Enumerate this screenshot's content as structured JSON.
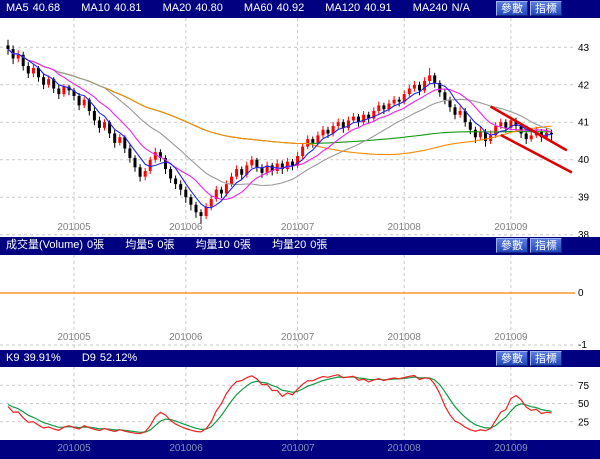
{
  "colors": {
    "header_bg": "#000080",
    "button_bg": "#2347b8",
    "button_text": "#ffffff",
    "chart_bg": "#ffffff",
    "grid": "#c9c9c9",
    "axis_text": "#000000",
    "date_text": "#808080",
    "bottom_date_text": "#8890b8",
    "up": "#ff0000",
    "down": "#000000",
    "trendline": "#dd0000",
    "ma5": "#2222ee",
    "ma10": "#ee22ee",
    "ma20": "#999999",
    "ma60": "#ff8800",
    "ma120": "#119911",
    "k_line": "#ee2222",
    "d_line": "#119944",
    "zero_line": "#ff8800"
  },
  "buttons": {
    "params": "參數",
    "indicator": "指標"
  },
  "panels": {
    "main": {
      "header": [
        {
          "label": "MA5",
          "value": "40.68"
        },
        {
          "label": "MA10",
          "value": "40.81"
        },
        {
          "label": "MA20",
          "value": "40.80"
        },
        {
          "label": "MA60",
          "value": "40.92"
        },
        {
          "label": "MA120",
          "value": "40.91"
        },
        {
          "label": "MA240",
          "value": "N/A"
        }
      ]
    },
    "volume": {
      "header": [
        {
          "label": "成交量(Volume)",
          "value": "0張"
        },
        {
          "label": "均量5",
          "value": "0張"
        },
        {
          "label": "均量10",
          "value": "0張"
        },
        {
          "label": "均量20",
          "value": "0張"
        }
      ]
    },
    "kd": {
      "header": [
        {
          "label": "K9",
          "value": "39.91%"
        },
        {
          "label": "D9",
          "value": "52.12%"
        }
      ]
    }
  },
  "chart_data": [
    {
      "type": "candlestick",
      "title": "daily candlestick with moving averages",
      "y_ticks": [
        43,
        42,
        41,
        40,
        39,
        38
      ],
      "ylim": [
        37.94,
        43.78
      ],
      "x_tick_labels": [
        "201005",
        "201006",
        "201007",
        "201008",
        "201009"
      ],
      "x_tick_indices": [
        13,
        35,
        57,
        78,
        99
      ],
      "ma_periods": [
        5,
        10,
        20,
        60,
        120
      ],
      "candles": [
        [
          43.05,
          43.2,
          42.8,
          42.95
        ],
        [
          42.95,
          43.05,
          42.55,
          42.7
        ],
        [
          42.7,
          42.92,
          42.6,
          42.8
        ],
        [
          42.8,
          42.88,
          42.38,
          42.5
        ],
        [
          42.5,
          42.6,
          42.18,
          42.3
        ],
        [
          42.3,
          42.55,
          42.2,
          42.45
        ],
        [
          42.45,
          42.5,
          42.08,
          42.2
        ],
        [
          42.2,
          42.3,
          41.88,
          42.0
        ],
        [
          42.0,
          42.25,
          41.92,
          42.15
        ],
        [
          42.15,
          42.2,
          41.78,
          41.9
        ],
        [
          41.9,
          42.0,
          41.62,
          41.75
        ],
        [
          41.75,
          42.02,
          41.68,
          41.95
        ],
        [
          41.95,
          42.0,
          41.72,
          41.85
        ],
        [
          41.85,
          41.92,
          41.58,
          41.7
        ],
        [
          41.7,
          41.78,
          41.32,
          41.45
        ],
        [
          41.45,
          41.68,
          41.38,
          41.6
        ],
        [
          41.6,
          41.65,
          41.18,
          41.3
        ],
        [
          41.3,
          41.4,
          40.92,
          41.05
        ],
        [
          41.05,
          41.15,
          40.72,
          40.85
        ],
        [
          40.85,
          41.08,
          40.78,
          41.0
        ],
        [
          41.0,
          41.05,
          40.58,
          40.7
        ],
        [
          40.7,
          40.8,
          40.32,
          40.45
        ],
        [
          40.45,
          40.68,
          40.38,
          40.6
        ],
        [
          40.6,
          40.65,
          40.18,
          40.3
        ],
        [
          40.3,
          40.4,
          39.92,
          40.05
        ],
        [
          40.05,
          40.12,
          39.68,
          39.8
        ],
        [
          39.8,
          39.88,
          39.42,
          39.55
        ],
        [
          39.55,
          39.78,
          39.45,
          39.7
        ],
        [
          39.7,
          40.08,
          39.62,
          40.0
        ],
        [
          40.0,
          40.32,
          39.92,
          40.2
        ],
        [
          40.2,
          40.28,
          39.95,
          40.05
        ],
        [
          40.05,
          40.12,
          39.62,
          39.75
        ],
        [
          39.75,
          39.82,
          39.38,
          39.5
        ],
        [
          39.5,
          39.58,
          39.22,
          39.35
        ],
        [
          39.35,
          39.45,
          39.05,
          39.2
        ],
        [
          39.2,
          39.28,
          38.85,
          39.0
        ],
        [
          39.0,
          39.08,
          38.65,
          38.8
        ],
        [
          38.8,
          38.88,
          38.45,
          38.6
        ],
        [
          38.6,
          38.68,
          38.3,
          38.5
        ],
        [
          38.5,
          38.85,
          38.42,
          38.75
        ],
        [
          38.75,
          39.05,
          38.65,
          38.95
        ],
        [
          38.95,
          39.3,
          38.88,
          39.2
        ],
        [
          39.2,
          39.28,
          38.98,
          39.1
        ],
        [
          39.1,
          39.45,
          39.02,
          39.35
        ],
        [
          39.35,
          39.65,
          39.28,
          39.55
        ],
        [
          39.55,
          39.85,
          39.48,
          39.75
        ],
        [
          39.75,
          39.82,
          39.48,
          39.6
        ],
        [
          39.6,
          39.95,
          39.52,
          39.85
        ],
        [
          39.85,
          40.1,
          39.78,
          40.0
        ],
        [
          40.0,
          40.05,
          39.68,
          39.8
        ],
        [
          39.8,
          39.88,
          39.52,
          39.65
        ],
        [
          39.65,
          39.95,
          39.58,
          39.85
        ],
        [
          39.85,
          39.92,
          39.58,
          39.7
        ],
        [
          39.7,
          40.0,
          39.62,
          39.9
        ],
        [
          39.9,
          39.98,
          39.62,
          39.75
        ],
        [
          39.75,
          40.05,
          39.68,
          39.95
        ],
        [
          39.95,
          40.02,
          39.72,
          39.85
        ],
        [
          39.85,
          40.2,
          39.78,
          40.1
        ],
        [
          40.1,
          40.45,
          40.02,
          40.35
        ],
        [
          40.35,
          40.65,
          40.28,
          40.55
        ],
        [
          40.55,
          40.62,
          40.32,
          40.45
        ],
        [
          40.45,
          40.75,
          40.38,
          40.65
        ],
        [
          40.65,
          40.9,
          40.58,
          40.8
        ],
        [
          40.8,
          40.88,
          40.58,
          40.7
        ],
        [
          40.7,
          41.0,
          40.62,
          40.9
        ],
        [
          40.9,
          41.1,
          40.82,
          41.0
        ],
        [
          41.0,
          41.08,
          40.72,
          40.85
        ],
        [
          40.85,
          41.15,
          40.78,
          41.05
        ],
        [
          41.05,
          41.25,
          40.98,
          41.15
        ],
        [
          41.15,
          41.22,
          40.88,
          41.0
        ],
        [
          41.0,
          41.3,
          40.92,
          41.2
        ],
        [
          41.2,
          41.28,
          40.98,
          41.1
        ],
        [
          41.1,
          41.4,
          41.02,
          41.3
        ],
        [
          41.3,
          41.55,
          41.22,
          41.45
        ],
        [
          41.45,
          41.52,
          41.22,
          41.35
        ],
        [
          41.35,
          41.6,
          41.28,
          41.5
        ],
        [
          41.5,
          41.7,
          41.42,
          41.6
        ],
        [
          41.6,
          41.68,
          41.42,
          41.55
        ],
        [
          41.55,
          41.85,
          41.48,
          41.75
        ],
        [
          41.75,
          42.0,
          41.68,
          41.9
        ],
        [
          41.9,
          42.1,
          41.82,
          42.0
        ],
        [
          42.0,
          42.08,
          41.72,
          41.85
        ],
        [
          41.85,
          42.2,
          41.78,
          42.1
        ],
        [
          42.1,
          42.45,
          42.02,
          42.25
        ],
        [
          42.25,
          42.32,
          41.92,
          42.05
        ],
        [
          42.05,
          42.12,
          41.68,
          41.8
        ],
        [
          41.8,
          41.88,
          41.48,
          41.6
        ],
        [
          41.6,
          41.68,
          41.28,
          41.4
        ],
        [
          41.4,
          41.48,
          41.08,
          41.2
        ],
        [
          41.2,
          41.42,
          41.12,
          41.3
        ],
        [
          41.3,
          41.38,
          40.88,
          41.0
        ],
        [
          41.0,
          41.08,
          40.68,
          40.8
        ],
        [
          40.8,
          40.88,
          40.45,
          40.6
        ],
        [
          40.6,
          40.88,
          40.52,
          40.75
        ],
        [
          40.75,
          40.82,
          40.35,
          40.5
        ],
        [
          40.5,
          40.78,
          40.42,
          40.65
        ],
        [
          40.65,
          41.0,
          40.58,
          40.9
        ],
        [
          40.9,
          41.1,
          40.82,
          41.0
        ],
        [
          41.0,
          41.08,
          40.72,
          40.85
        ],
        [
          40.85,
          41.15,
          40.78,
          41.05
        ],
        [
          41.05,
          41.12,
          40.78,
          40.9
        ],
        [
          40.9,
          40.98,
          40.58,
          40.7
        ],
        [
          40.7,
          40.78,
          40.42,
          40.55
        ],
        [
          40.55,
          40.78,
          40.48,
          40.65
        ],
        [
          40.65,
          40.88,
          40.58,
          40.75
        ],
        [
          40.75,
          40.82,
          40.48,
          40.6
        ],
        [
          40.6,
          40.85,
          40.52,
          40.72
        ],
        [
          40.72,
          40.8,
          40.45,
          40.68
        ]
      ],
      "trendlines": [
        {
          "i1": 95,
          "p1": 41.42,
          "i2": 110,
          "p2": 40.25
        },
        {
          "i1": 97,
          "p1": 40.66,
          "i2": 111,
          "p2": 39.66
        }
      ]
    },
    {
      "type": "bar",
      "title": "成交量(Volume)",
      "values_constant": 0,
      "y_ticks": [
        "0",
        "-1"
      ],
      "ma_periods": [
        5,
        10,
        20
      ],
      "x_ticks_same_as_main": true
    },
    {
      "type": "line",
      "title": "KD stochastic (9)",
      "series": [
        {
          "name": "K9",
          "period": 9
        },
        {
          "name": "D9",
          "period": 9
        }
      ],
      "y_ticks": [
        75,
        50,
        25
      ],
      "ylim": [
        0,
        100
      ],
      "derived_from": "candles",
      "x_ticks_same_as_main": true
    }
  ]
}
